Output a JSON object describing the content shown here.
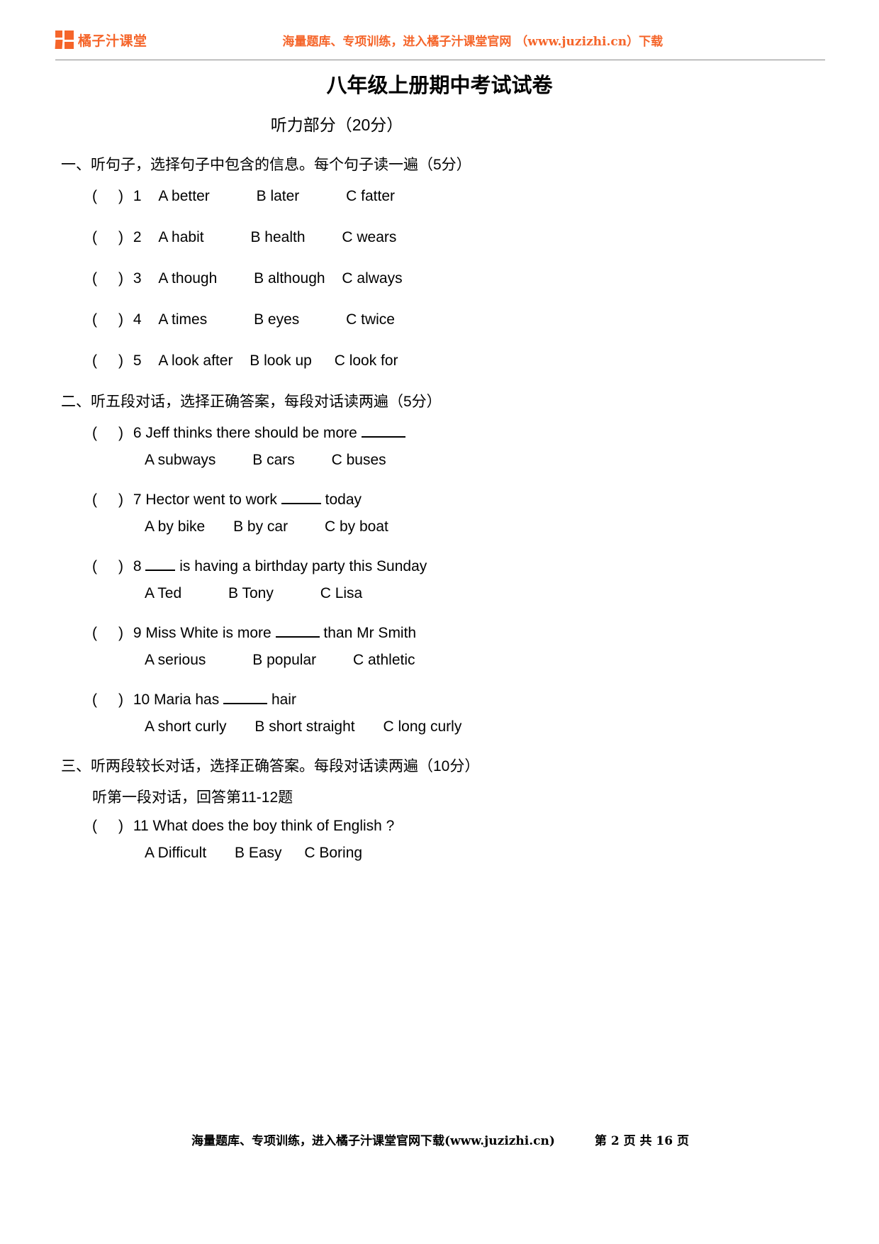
{
  "header": {
    "brand_name": "橘子汁课堂",
    "promo_text": "海量题库、专项训练，进入橘子汁课堂官网 （www.juzizhi.cn）下载",
    "brand_color": "#F5652A"
  },
  "title": {
    "strong_part": "八年级上册",
    "normal_part": "期中考试试卷",
    "section_score": "听力部分（20分）"
  },
  "sections": {
    "one": {
      "heading": "一、听句子，选择句子中包含的信息。每个句子读一遍（5分）",
      "questions": [
        {
          "num": "1",
          "a": "A better",
          "b": "B later",
          "c": "C fatter"
        },
        {
          "num": "2",
          "a": "A habit",
          "b": "B health",
          "c": "C wears"
        },
        {
          "num": "3",
          "a": "A though",
          "b": "B although",
          "c": "C always"
        },
        {
          "num": "4",
          "a": "A times",
          "b": "B eyes",
          "c": "C twice"
        },
        {
          "num": "5",
          "a": "A look after",
          "b": "B look up",
          "c": "C look for"
        }
      ]
    },
    "two": {
      "heading": "二、听五段对话，选择正确答案，每段对话读两遍（5分）",
      "questions": [
        {
          "num": "6",
          "stem_before": "6 Jeff thinks there should be more",
          "stem_after": "",
          "a": "A subways",
          "b": "B cars",
          "c": "C buses"
        },
        {
          "num": "7",
          "stem_before": "7 Hector went to work",
          "stem_after": "today",
          "a": "A by bike",
          "b": "B by car",
          "c": "C by boat"
        },
        {
          "num": "8",
          "stem_before": "8",
          "stem_after": "is having a birthday party this Sunday",
          "a": "A Ted",
          "b": "B Tony",
          "c": "C Lisa"
        },
        {
          "num": "9",
          "stem_before": "9 Miss White is more",
          "stem_after": "than Mr Smith",
          "a": "A serious",
          "b": "B popular",
          "c": "C athletic"
        },
        {
          "num": "10",
          "stem_before": "10 Maria has",
          "stem_after": "hair",
          "a": "A short curly",
          "b": "B short straight",
          "c": "C long curly"
        }
      ]
    },
    "three": {
      "heading": "三、听两段较长对话，选择正确答案。每段对话读两遍（10分）",
      "subheading": "听第一段对话，回答第11-12题",
      "questions": [
        {
          "num": "11",
          "stem": "11 What does the boy think of English ?",
          "a": "A Difficult",
          "b": "B Easy",
          "c": "C Boring"
        }
      ]
    }
  },
  "paren": {
    "left": "(",
    "right": ")"
  },
  "footer": {
    "main_text": "海量题库、专项训练，进入橘子汁课堂官网下载(www.juzizhi.cn)",
    "page_text": "第 2 页 共 16 页"
  }
}
